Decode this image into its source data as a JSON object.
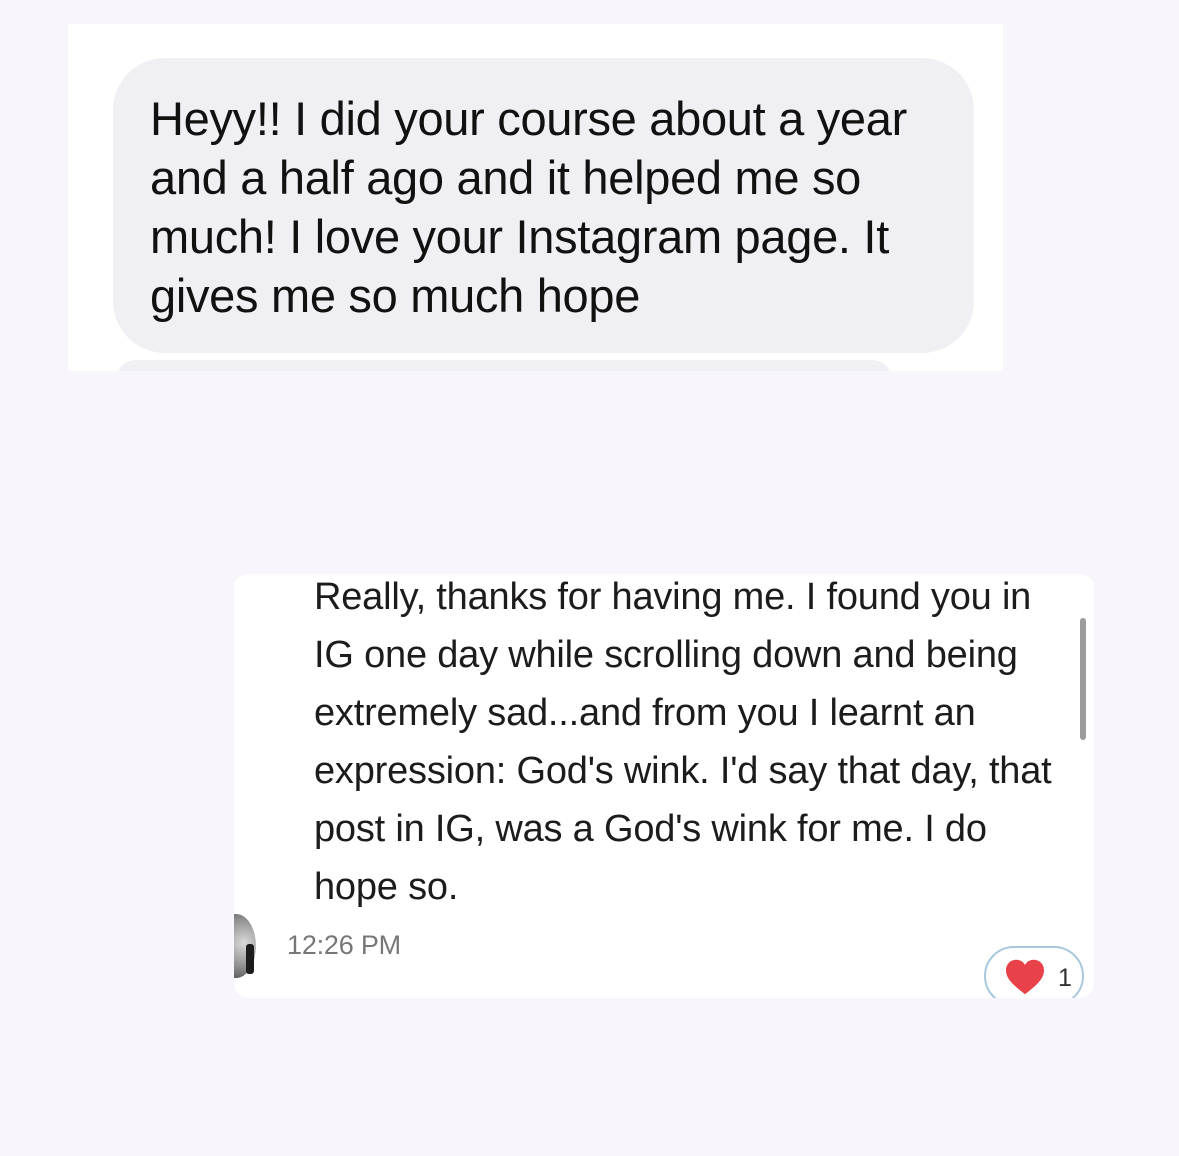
{
  "incoming_message": {
    "text": "Heyy!! I did your course about a year and a half ago and it helped me so much! I love your Instagram page. It gives me so much hope"
  },
  "reply_message": {
    "text": "Really, thanks for having me.  I found you in IG one day while scrolling down and being extremely sad...and from you I learnt an expression: God's wink.  I'd say that day, that post in IG, was a God's wink for me.  I do hope so.",
    "timestamp": "12:26 PM",
    "reaction": {
      "icon": "heart-icon",
      "color": "#e8414a",
      "count": "1"
    }
  }
}
